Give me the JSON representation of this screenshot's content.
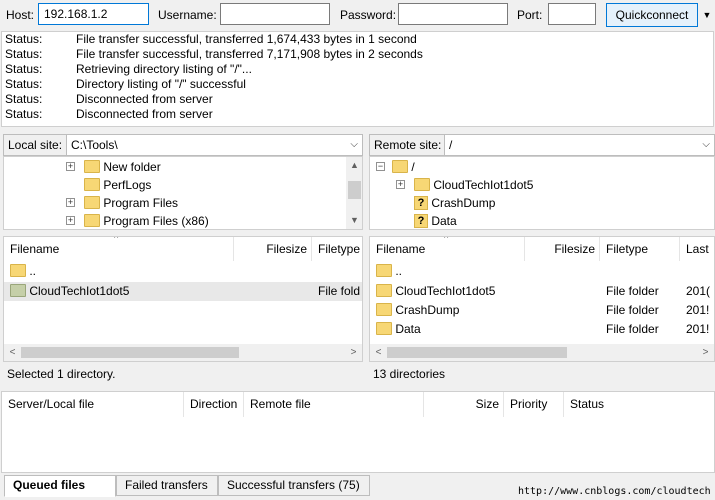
{
  "toolbar": {
    "host_label": "Host:",
    "host_value": "192.168.1.2",
    "username_label": "Username:",
    "username_value": "",
    "password_label": "Password:",
    "password_value": "",
    "port_label": "Port:",
    "port_value": "",
    "quickconnect_label": "Quickconnect"
  },
  "log": [
    {
      "key": "Status:",
      "text": "File transfer successful, transferred 1,674,433 bytes in 1 second"
    },
    {
      "key": "Status:",
      "text": "File transfer successful, transferred 7,171,908 bytes in 2 seconds"
    },
    {
      "key": "Status:",
      "text": "Retrieving directory listing of \"/\"..."
    },
    {
      "key": "Status:",
      "text": "Directory listing of \"/\" successful"
    },
    {
      "key": "Status:",
      "text": "Disconnected from server"
    },
    {
      "key": "Status:",
      "text": "Disconnected from server"
    }
  ],
  "local": {
    "site_label": "Local site:",
    "site_path": "C:\\Tools\\",
    "tree": [
      "New folder",
      "PerfLogs",
      "Program Files",
      "Program Files (x86)"
    ],
    "columns": {
      "filename": "Filename",
      "filesize": "Filesize",
      "filetype": "Filetype"
    },
    "files": [
      {
        "name": "..",
        "type": ""
      },
      {
        "name": "CloudTechIot1dot5",
        "type": "File fold"
      }
    ],
    "status": "Selected 1 directory."
  },
  "remote": {
    "site_label": "Remote site:",
    "site_path": "/",
    "tree": [
      "/",
      "CloudTechIot1dot5",
      "CrashDump",
      "Data"
    ],
    "columns": {
      "filename": "Filename",
      "filesize": "Filesize",
      "filetype": "Filetype",
      "last": "Last"
    },
    "files": [
      {
        "name": "..",
        "type": "",
        "last": ""
      },
      {
        "name": "CloudTechIot1dot5",
        "type": "File folder",
        "last": "201("
      },
      {
        "name": "CrashDump",
        "type": "File folder",
        "last": "201!"
      },
      {
        "name": "Data",
        "type": "File folder",
        "last": "201!"
      }
    ],
    "status": "13 directories"
  },
  "queue": {
    "columns": {
      "server_local": "Server/Local file",
      "direction": "Direction",
      "remote": "Remote file",
      "size": "Size",
      "priority": "Priority",
      "status": "Status"
    },
    "tabs": [
      "Queued files",
      "Failed transfers",
      "Successful transfers (75)"
    ]
  },
  "watermark": "http://www.cnblogs.com/cloudtech"
}
